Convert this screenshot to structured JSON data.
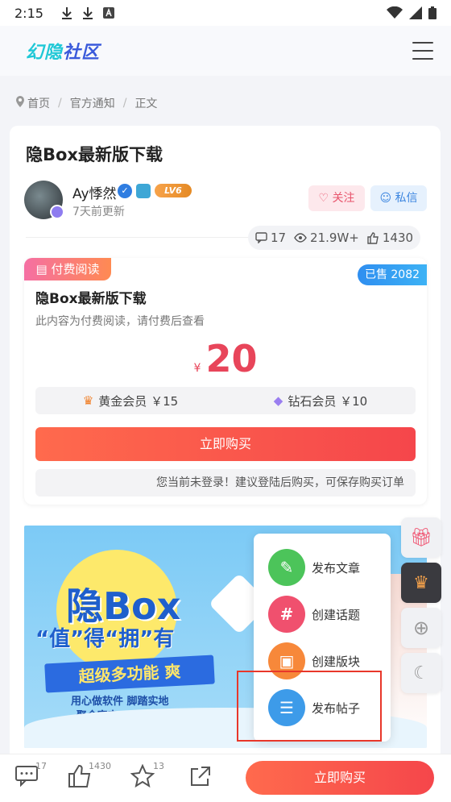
{
  "status_bar": {
    "time": "2:15"
  },
  "header": {
    "logo_part1": "幻隐",
    "logo_part2": "社区"
  },
  "breadcrumb": {
    "home": "首页",
    "category": "官方通知",
    "current": "正文"
  },
  "post": {
    "title": "隐Box最新版下载",
    "author": {
      "name": "Ay悸然",
      "level": "LV6",
      "time": "7天前更新"
    },
    "follow_label": "关注",
    "message_label": "私信",
    "stats": {
      "comments": "17",
      "views": "21.9W+",
      "likes": "1430"
    }
  },
  "paywall": {
    "tag": "付费阅读",
    "sold": "已售 2082",
    "title": "隐Box最新版下载",
    "description": "此内容为付费阅读，请付费后查看",
    "currency": "¥",
    "price": "20",
    "gold_member": "黄金会员 ￥15",
    "diamond_member": "钻石会员 ￥10",
    "buy_label": "立即购买",
    "login_tip": "您当前未登录！建议登陆后购买，可保存购买订单"
  },
  "banner": {
    "title": "隐Box",
    "subtitle": "“值”得“拥”有",
    "ribbon": "超级多功能  爽",
    "line1": "用心做软件 脚踏实地",
    "line2": "聚合宇宙“工具箱”"
  },
  "popup_menu": {
    "items": [
      {
        "label": "发布文章",
        "icon": "pencil-icon",
        "color": "#4cc45a"
      },
      {
        "label": "创建话题",
        "icon": "hash-icon",
        "color": "#f0506e"
      },
      {
        "label": "创建版块",
        "icon": "box-icon",
        "color": "#f7883a"
      },
      {
        "label": "发布帖子",
        "icon": "chat-icon",
        "color": "#3d9be9"
      }
    ]
  },
  "side_buttons": [
    "gift-icon",
    "crown-icon",
    "plus-icon",
    "moon-icon"
  ],
  "bottom_bar": {
    "comments": "17",
    "likes": "1430",
    "favorites": "13",
    "buy_label": "立即购买"
  },
  "colors": {
    "accent_red": "#f5464b",
    "accent_blue": "#3d86e0",
    "brand_pink": "#f56fa3"
  }
}
